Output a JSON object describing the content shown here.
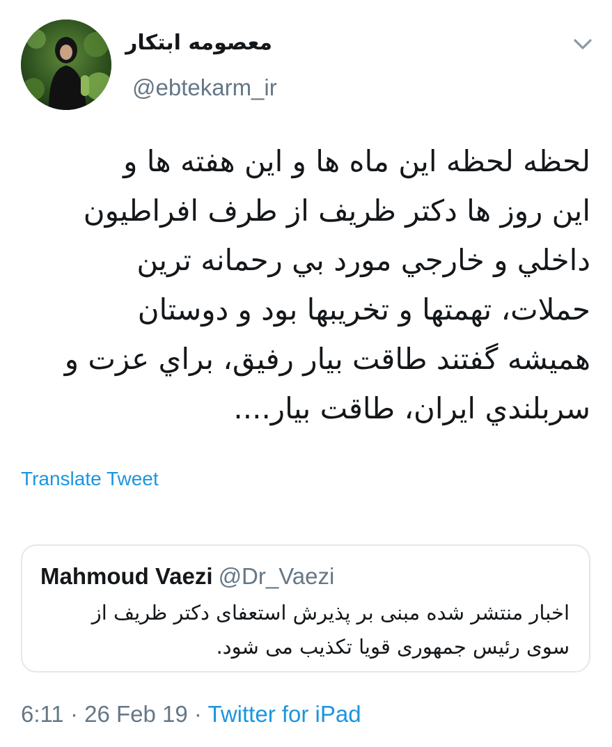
{
  "author": {
    "display_name": "معصومه ابتکار",
    "handle": "@ebtekarm_ir",
    "avatar_icon": "profile-photo"
  },
  "menu_icon": "chevron-down-icon",
  "tweet": {
    "lines": [
      "لحظه لحظه این ماه ها و این هفته ها و",
      "این روز ها دکتر ظریف از طرف افراطیون",
      "داخلي و خارجي مورد بي رحمانه ترين",
      "حملات، تهمتها و تخريبها بود و دوستان",
      "هميشه گفتند طاقت بيار رفيق، براي عزت و",
      "سربلندي ايران، طاقت بيار...."
    ],
    "translate_label": "Translate Tweet"
  },
  "quoted_tweet": {
    "name": "Mahmoud Vaezi",
    "handle": "@Dr_Vaezi",
    "lines": [
      "اخبار منتشر شده مبنی بر پذیرش استعفای دکتر ظریف از",
      "سوی رئیس جمهوری قویا تکذیب می شود."
    ]
  },
  "meta": {
    "time": "6:11",
    "separator": "·",
    "date": "26 Feb 19",
    "source": "Twitter for iPad"
  },
  "colors": {
    "link": "#1b95e0",
    "secondary_text": "#657786",
    "primary_text": "#14171a",
    "border": "#e1e8ed"
  }
}
